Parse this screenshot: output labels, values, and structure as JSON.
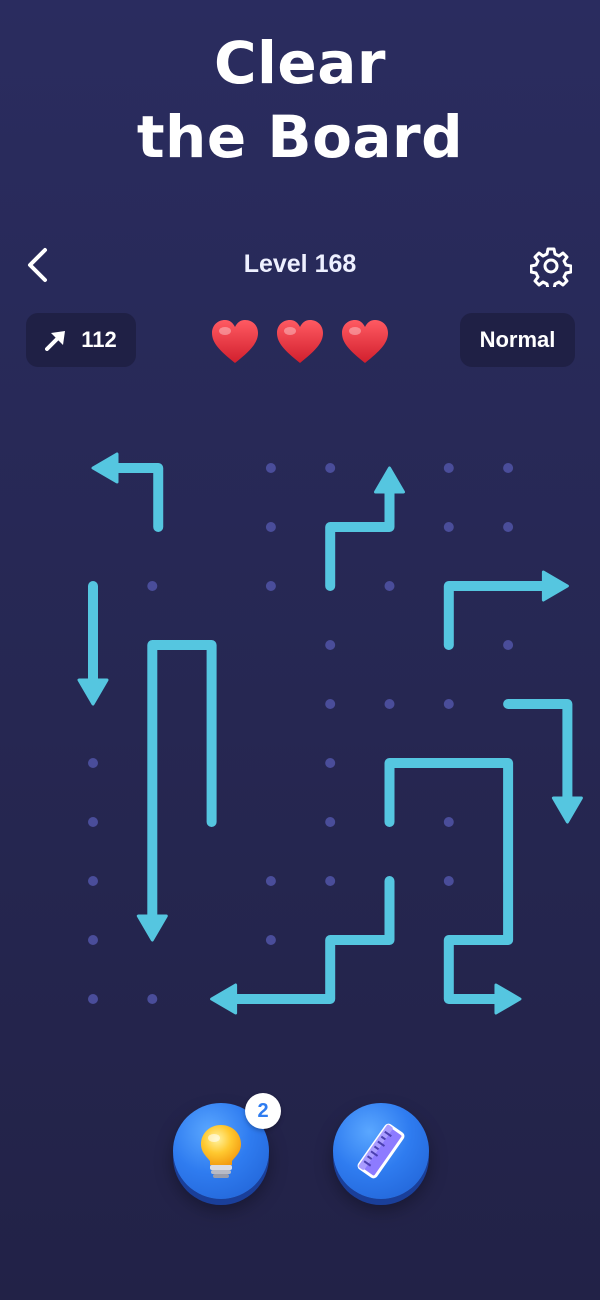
{
  "title": {
    "line1": "Clear",
    "line2": "the Board"
  },
  "header": {
    "level_label": "Level 168",
    "back_icon": "chevron-left-icon",
    "settings_icon": "gear-icon"
  },
  "stats": {
    "moves_icon": "arrow-icon",
    "moves_count": "112",
    "hearts_remaining": 3,
    "mode_label": "Normal"
  },
  "tools": {
    "hint_icon": "lightbulb-icon",
    "hint_count": "2",
    "ruler_icon": "ruler-icon"
  },
  "colors": {
    "background": "#2a2c5f",
    "arrow": "#55c6e0",
    "dot": "#4a4d9a",
    "heart": "#e8333f",
    "button": "#2f7cf0"
  },
  "board": {
    "grid_cols": 8,
    "grid_rows": 10,
    "dots": [
      [
        3,
        0
      ],
      [
        4,
        0
      ],
      [
        6,
        0
      ],
      [
        7,
        0
      ],
      [
        3,
        1
      ],
      [
        6,
        1
      ],
      [
        7,
        1
      ],
      [
        1,
        2
      ],
      [
        3,
        2
      ],
      [
        5,
        2
      ],
      [
        4,
        3
      ],
      [
        6,
        3
      ],
      [
        7,
        3
      ],
      [
        4,
        4
      ],
      [
        5,
        4
      ],
      [
        6,
        4
      ],
      [
        0,
        5
      ],
      [
        4,
        5
      ],
      [
        0,
        6
      ],
      [
        4,
        6
      ],
      [
        6,
        6
      ],
      [
        0,
        7
      ],
      [
        3,
        7
      ],
      [
        4,
        7
      ],
      [
        6,
        7
      ],
      [
        7,
        7
      ],
      [
        0,
        8
      ],
      [
        3,
        8
      ],
      [
        7,
        8
      ],
      [
        0,
        9
      ],
      [
        1,
        9
      ],
      [
        7,
        9
      ]
    ],
    "arrows": [
      {
        "points": [
          [
            1.1,
            1
          ],
          [
            1.1,
            0
          ],
          [
            0,
            0
          ]
        ]
      },
      {
        "points": [
          [
            4,
            2
          ],
          [
            4,
            1
          ],
          [
            5,
            1
          ],
          [
            5,
            0
          ]
        ]
      },
      {
        "points": [
          [
            0,
            2
          ],
          [
            0,
            4
          ]
        ]
      },
      {
        "points": [
          [
            6,
            3
          ],
          [
            6,
            2
          ],
          [
            8,
            2
          ]
        ]
      },
      {
        "points": [
          [
            2,
            6
          ],
          [
            2,
            3
          ],
          [
            1,
            3
          ],
          [
            1,
            8
          ]
        ]
      },
      {
        "points": [
          [
            7,
            4
          ],
          [
            8,
            4
          ],
          [
            8,
            6
          ]
        ]
      },
      {
        "points": [
          [
            5,
            6
          ],
          [
            5,
            5
          ],
          [
            7,
            5
          ],
          [
            7,
            8
          ],
          [
            6,
            8
          ],
          [
            6,
            9
          ],
          [
            7,
            2,
            9
          ]
        ]
      },
      {
        "points": [
          [
            5,
            7
          ],
          [
            5,
            8
          ],
          [
            4,
            8
          ],
          [
            4,
            9
          ],
          [
            2,
            9
          ]
        ]
      }
    ]
  }
}
